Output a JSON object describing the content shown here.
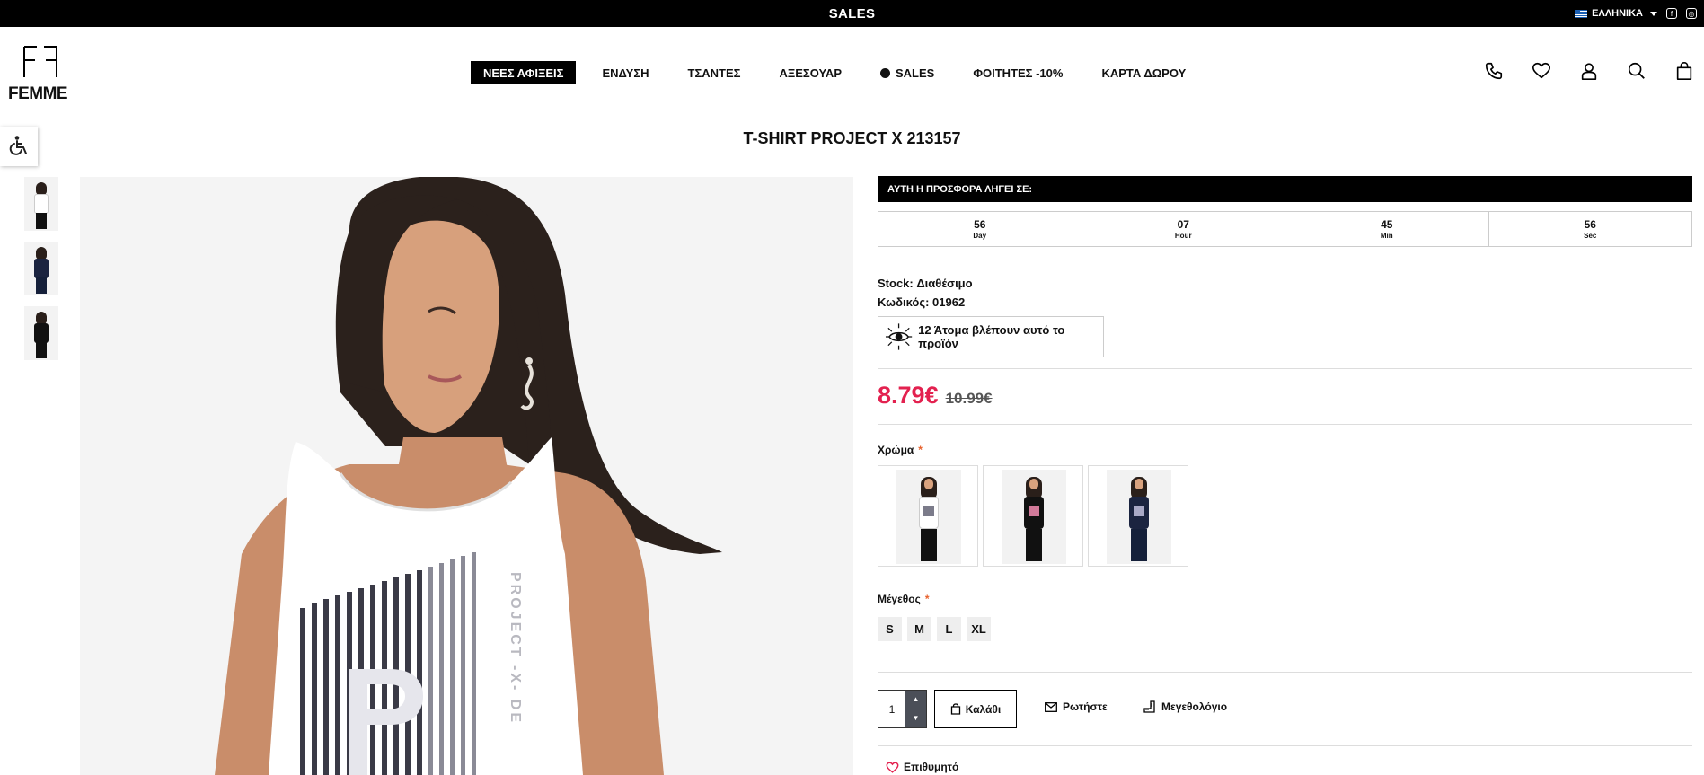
{
  "topbar": {
    "promo": "SALES",
    "language": "ΕΛΛΗΝΙΚΑ"
  },
  "brand": {
    "logo_text": "FEMME"
  },
  "nav": {
    "items": [
      {
        "label": "ΝΕΕΣ ΑΦΙΞΕΙΣ",
        "active": true
      },
      {
        "label": "ΕΝΔΥΣΗ"
      },
      {
        "label": "ΤΣΑΝΤΕΣ"
      },
      {
        "label": "ΑΞΕΣΟΥΑΡ"
      },
      {
        "label": "SALES"
      },
      {
        "label": "ΦΟΙΤΗΤΕΣ -10%"
      },
      {
        "label": "ΚΑΡΤΑ ΔΩΡΟΥ"
      }
    ]
  },
  "header_icons": [
    "phone-icon",
    "heart-icon",
    "user-icon",
    "search-icon",
    "bag-icon"
  ],
  "product": {
    "title": "T-SHIRT PROJECT X 213157",
    "offer_banner": "ΑΥΤΗ Η ΠΡΟΣΦΟΡΑ ΛΗΓΕΙ ΣΕ:",
    "countdown": [
      {
        "value": "56",
        "unit": "Day"
      },
      {
        "value": "07",
        "unit": "Hour"
      },
      {
        "value": "45",
        "unit": "Min"
      },
      {
        "value": "56",
        "unit": "Sec"
      }
    ],
    "stock": "Stock: Διαθέσιμο",
    "code": "Κωδικός: 01962",
    "viewers": "12 Άτομα βλέπουν αυτό το προϊόν",
    "price_now": "8.79€",
    "price_old": "10.99€",
    "color_label": "Χρώμα",
    "required_mark": "*",
    "size_label": "Μέγεθος",
    "sizes": [
      "S",
      "M",
      "L",
      "XL"
    ],
    "quantity": "1",
    "cart_label": "Καλάθι",
    "ask_label": "Ρωτήστε",
    "sizechart_label": "Μεγεθολόγιο",
    "wishlist_label": "Επιθυμητό"
  },
  "colors": {
    "accent_price": "#e3214f",
    "required": "#e8612c",
    "topbar": "#000000"
  }
}
